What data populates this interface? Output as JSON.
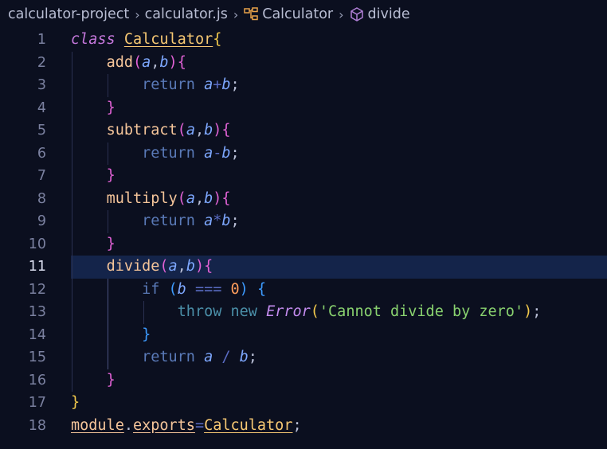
{
  "breadcrumb": {
    "project": "calculator-project",
    "file": "calculator.js",
    "class_name": "Calculator",
    "method": "divide",
    "separator": "›"
  },
  "editor": {
    "current_line": 11,
    "lines": [
      {
        "number": "1"
      },
      {
        "number": "2"
      },
      {
        "number": "3"
      },
      {
        "number": "4"
      },
      {
        "number": "5"
      },
      {
        "number": "6"
      },
      {
        "number": "7"
      },
      {
        "number": "8"
      },
      {
        "number": "9"
      },
      {
        "number": "10"
      },
      {
        "number": "11"
      },
      {
        "number": "12"
      },
      {
        "number": "13"
      },
      {
        "number": "14"
      },
      {
        "number": "15"
      },
      {
        "number": "16"
      },
      {
        "number": "17"
      },
      {
        "number": "18"
      }
    ],
    "code": {
      "kw_class": "class",
      "class_name": "Calculator",
      "open_brace": "{",
      "close_brace": "}",
      "add": "add",
      "subtract": "subtract",
      "multiply": "multiply",
      "divide": "divide",
      "param_a": "a",
      "param_b": "b",
      "paren_open": "(",
      "paren_close": ")",
      "comma": ",",
      "return": "return",
      "plus": "+",
      "minus": "-",
      "times": "*",
      "slash": "/",
      "semicolon": ";",
      "if": "if",
      "strict_eq": "===",
      "zero": "0",
      "throw": "throw",
      "new": "new",
      "error": "Error",
      "message": "'Cannot divide by zero'",
      "module": "module",
      "dot": ".",
      "exports": "exports",
      "equals": "="
    }
  },
  "colors": {
    "background": "#0b0f1f",
    "current_line": "#14244a",
    "keyword": "#c678dd",
    "class_name": "#f7c873",
    "function_name": "#f5c59a",
    "parameter": "#7ea8ff",
    "string": "#89d26f",
    "number": "#ff9d5c"
  }
}
